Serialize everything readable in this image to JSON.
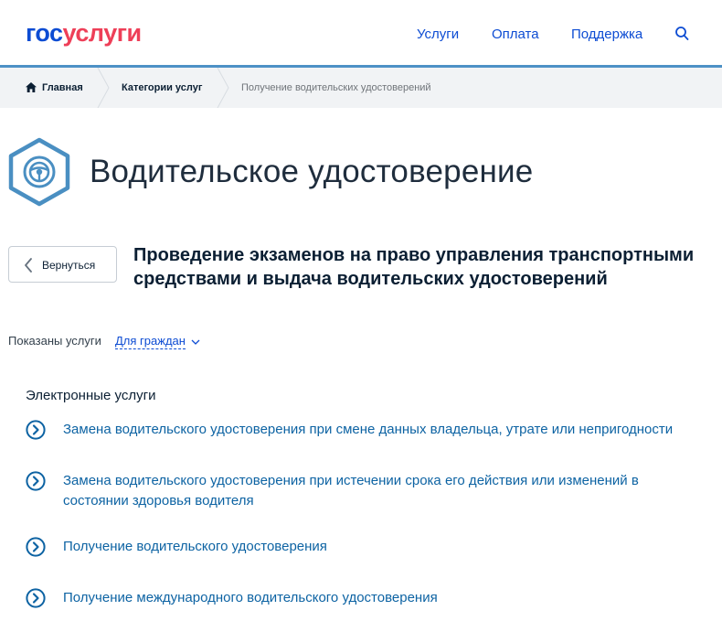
{
  "header": {
    "logo_part1": "гос",
    "logo_part2": "услуги",
    "nav": {
      "services": "Услуги",
      "payment": "Оплата",
      "support": "Поддержка"
    },
    "search_icon": "search-icon"
  },
  "breadcrumbs": {
    "home": "Главная",
    "categories": "Категории услуг",
    "current": "Получение водительских удостоверений"
  },
  "page": {
    "title": "Водительское удостоверение",
    "icon": "steering-wheel-icon"
  },
  "back_button": "Вернуться",
  "section_title": "Проведение экзаменов на право управления транспортными средствами и выдача водительских удостоверений",
  "filter": {
    "label": "Показаны услуги",
    "value": "Для граждан"
  },
  "services": {
    "heading": "Электронные услуги",
    "items": [
      "Замена водительского удостоверения при смене данных владельца, утрате или непригодности",
      "Замена водительского удостоверения при истечении срока его действия или изменений в состоянии здоровья водителя",
      "Получение водительского удостоверения",
      "Получение международного водительского удостоверения"
    ]
  },
  "colors": {
    "brand_blue": "#0d4cd3",
    "brand_red": "#ee3f58",
    "link": "#0d63a3",
    "header_line": "#4d91c6",
    "icon_blue": "#4a8fc2"
  }
}
